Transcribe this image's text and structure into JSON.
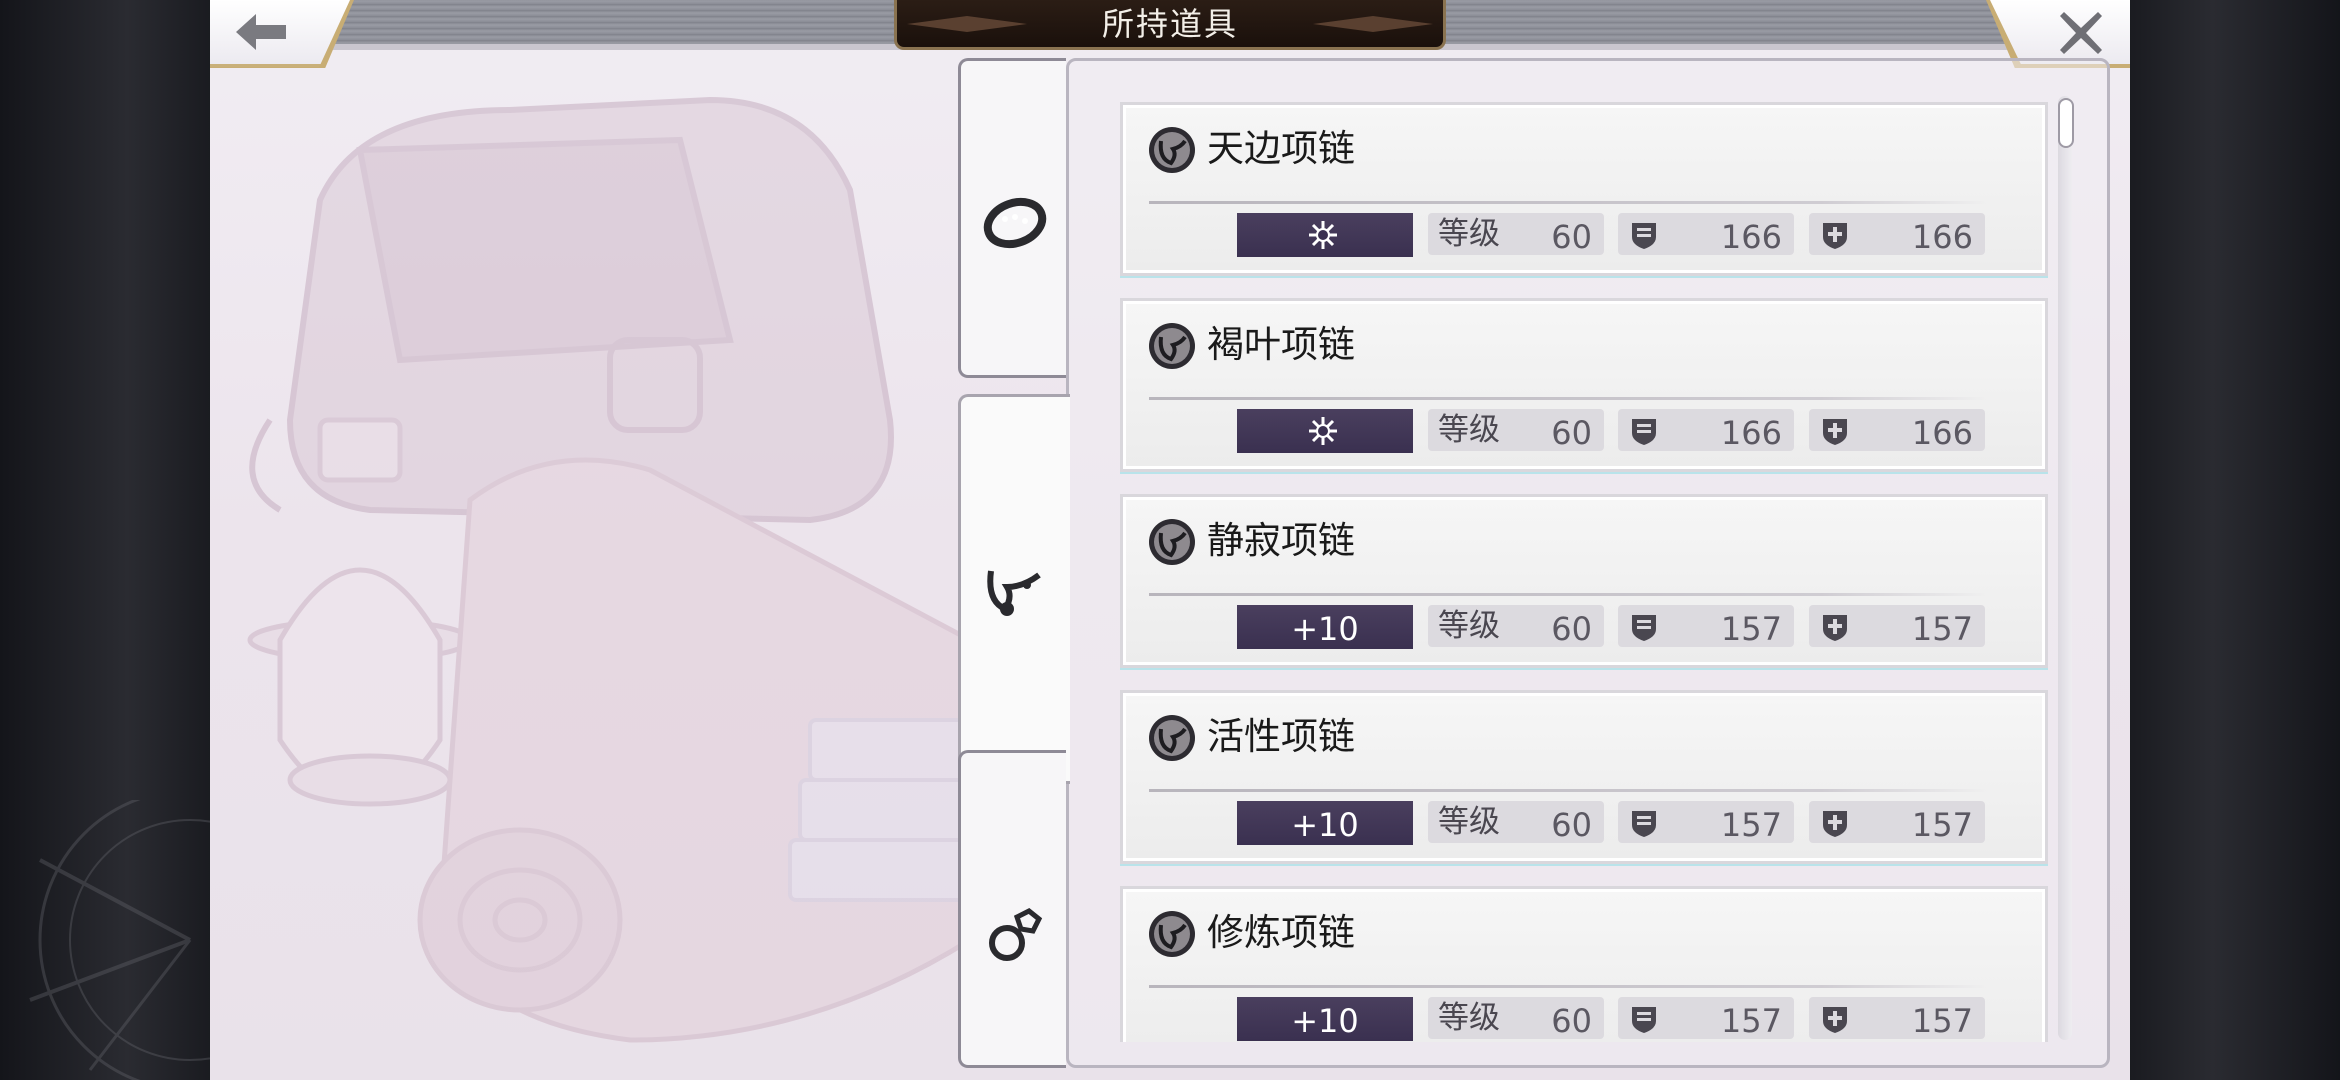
{
  "header": {
    "title": "所持道具",
    "back_icon": "left-arrow-icon",
    "close_icon": "close-x-icon"
  },
  "tabs": [
    {
      "icon": "bracelet-icon",
      "active": false
    },
    {
      "icon": "necklace-icon",
      "active": true
    },
    {
      "icon": "ring-icon",
      "active": false
    }
  ],
  "stats_labels": {
    "level": "等级",
    "defense_icon": "shield-icon",
    "magic_defense_icon": "cross-shield-icon"
  },
  "items": [
    {
      "name": "天边项链",
      "enhance": "",
      "enhance_icon": "star-burst-icon",
      "level": "60",
      "defense": "166",
      "magic_defense": "166"
    },
    {
      "name": "褐叶项链",
      "enhance": "",
      "enhance_icon": "star-burst-icon",
      "level": "60",
      "defense": "166",
      "magic_defense": "166"
    },
    {
      "name": "静寂项链",
      "enhance": "+10",
      "enhance_icon": "",
      "level": "60",
      "defense": "157",
      "magic_defense": "157"
    },
    {
      "name": "活性项链",
      "enhance": "+10",
      "enhance_icon": "",
      "level": "60",
      "defense": "157",
      "magic_defense": "157"
    },
    {
      "name": "修炼项链",
      "enhance": "+10",
      "enhance_icon": "",
      "level": "60",
      "defense": "157",
      "magic_defense": "157"
    }
  ],
  "colors": {
    "accent_gold": "#c8ad74",
    "enhance_bar": "#3a3050",
    "stat_bg": "#dcdadf"
  }
}
